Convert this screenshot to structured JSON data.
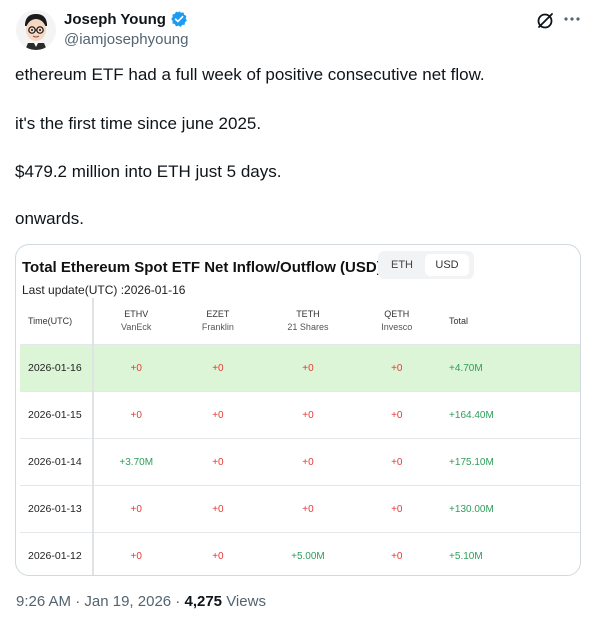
{
  "author": {
    "display_name": "Joseph Young",
    "handle": "@iamjosephyoung"
  },
  "icons": {
    "verified": "verified-badge-icon",
    "grok": "grok-icon",
    "more": "more-icon"
  },
  "tweet": {
    "lines": [
      "ethereum ETF had a full week of positive consecutive net flow.",
      "it's the first time since june 2025.",
      "$479.2 million into ETH just 5 days.",
      "onwards."
    ]
  },
  "card": {
    "title": "Total Ethereum Spot ETF Net Inflow/Outflow (USD)",
    "last_update": "Last update(UTC) :2026-01-16",
    "toggle": {
      "eth": "ETH",
      "usd": "USD",
      "selected": "USD"
    },
    "headers": {
      "time": "Time(UTC)",
      "ethv": "ETHV",
      "ethv_sub": "VanEck",
      "ezet": "EZET",
      "ezet_sub": "Franklin",
      "teth": "TETH",
      "teth_sub": "21 Shares",
      "qeth": "QETH",
      "qeth_sub": "Invesco",
      "total": "Total"
    },
    "rows": [
      {
        "date": "2026-01-16",
        "ethv": "+0",
        "ezet": "+0",
        "teth": "+0",
        "qeth": "+0",
        "total": "+4.70M"
      },
      {
        "date": "2026-01-15",
        "ethv": "+0",
        "ezet": "+0",
        "teth": "+0",
        "qeth": "+0",
        "total": "+164.40M"
      },
      {
        "date": "2026-01-14",
        "ethv": "+3.70M",
        "ezet": "+0",
        "teth": "+0",
        "qeth": "+0",
        "total": "+175.10M"
      },
      {
        "date": "2026-01-13",
        "ethv": "+0",
        "ezet": "+0",
        "teth": "+0",
        "qeth": "+0",
        "total": "+130.00M"
      },
      {
        "date": "2026-01-12",
        "ethv": "+0",
        "ezet": "+0",
        "teth": "+5.00M",
        "qeth": "+0",
        "total": "+5.10M"
      }
    ],
    "colors": {
      "positive": "#2e9e5b",
      "zero": "#e53935",
      "highlight": "#dcf5d6"
    }
  },
  "meta": {
    "time": "9:26 AM",
    "separator": " · ",
    "date": "Jan 19, 2026",
    "views_count": "4,275",
    "views_label": " Views"
  }
}
